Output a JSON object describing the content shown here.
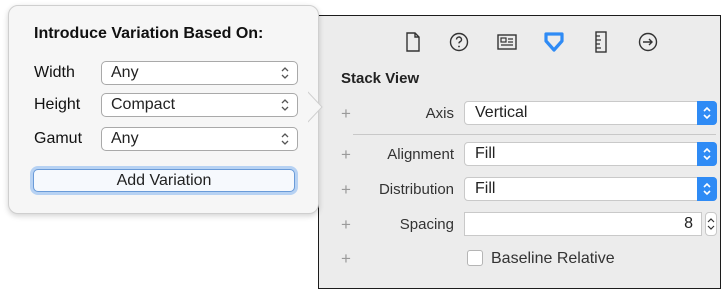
{
  "popover": {
    "title": "Introduce Variation Based On:",
    "rows": [
      {
        "label": "Width",
        "value": "Any"
      },
      {
        "label": "Height",
        "value": "Compact"
      },
      {
        "label": "Gamut",
        "value": "Any"
      }
    ],
    "add_button": "Add Variation"
  },
  "inspector": {
    "toolbar_icons": [
      "file-icon",
      "help-icon",
      "identity-icon",
      "attributes-icon",
      "size-icon",
      "connections-icon"
    ],
    "active_icon": "attributes-icon",
    "accent_color": "#2f8bf5",
    "section_title": "Stack View",
    "axis": {
      "plus": "+",
      "label": "Axis",
      "value": "Vertical"
    },
    "alignment": {
      "plus": "+",
      "label": "Alignment",
      "value": "Fill"
    },
    "distribution": {
      "plus": "+",
      "label": "Distribution",
      "value": "Fill"
    },
    "spacing": {
      "plus": "+",
      "label": "Spacing",
      "value": "8"
    },
    "baseline": {
      "plus": "+",
      "label": "Baseline Relative",
      "checked": false
    }
  }
}
